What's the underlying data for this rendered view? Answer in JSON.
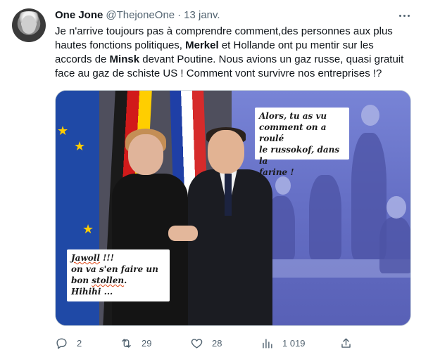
{
  "tweet": {
    "author_name": "One Jone",
    "handle": "@ThejoneOne",
    "separator": "·",
    "date": "13 janv.",
    "text_parts": [
      {
        "text": "Je n'arrive toujours pas à comprendre comment,des personnes aux plus hautes fonctions politiques, ",
        "bold": false
      },
      {
        "text": "Merkel",
        "bold": true
      },
      {
        "text": " et Hollande ont pu mentir sur les accords de ",
        "bold": false
      },
      {
        "text": "Minsk",
        "bold": true
      },
      {
        "text": " devant Poutine. Nous avions un gaz russe, quasi gratuit face au gaz de schiste US ! Comment vont survivre nos entreprises !?",
        "bold": false
      }
    ]
  },
  "image": {
    "bubble_right": [
      "Alors, tu as vu",
      "comment on a roulé",
      "le russokof, dans la",
      "farine !"
    ],
    "bubble_left_line1_word": "Jawoll",
    "bubble_left_line1_rest": " !!!",
    "bubble_left_line2": "on  va s'en faire un",
    "bubble_left_line3_pre": "bon ",
    "bubble_left_line3_word": "stollen",
    "bubble_left_line3_post": ".",
    "bubble_left_line4": "Hihihi ..."
  },
  "actions": {
    "replies": "2",
    "retweets": "29",
    "likes": "28",
    "views": "1 019"
  },
  "icons": {
    "more": "more-icon",
    "reply": "reply-icon",
    "retweet": "retweet-icon",
    "like": "like-icon",
    "views": "views-icon",
    "share": "share-icon"
  },
  "colors": {
    "text": "#0f1419",
    "secondary": "#536471",
    "border": "#cfd9de"
  }
}
